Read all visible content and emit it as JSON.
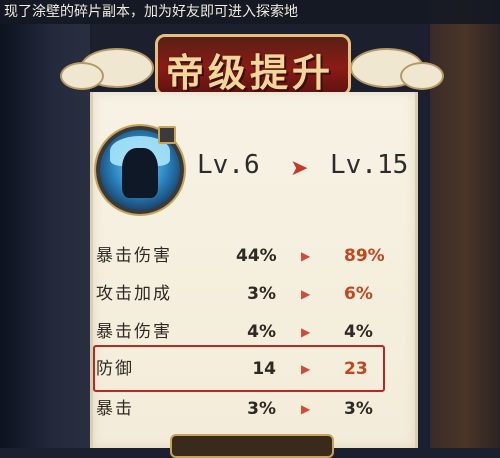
{
  "banner": {
    "text": "现了涂壁的碎片副本，加为好友即可进入探索地"
  },
  "title": "帝级提升",
  "level": {
    "from": "Lv.6",
    "to": "Lv.15"
  },
  "stats": [
    {
      "label": "暴击伤害",
      "from": "44%",
      "to": "89%",
      "changed": true
    },
    {
      "label": "攻击加成",
      "from": "3%",
      "to": "6%",
      "changed": true
    },
    {
      "label": "暴击伤害",
      "from": "4%",
      "to": "4%",
      "changed": false
    },
    {
      "label": "防御",
      "from": "14",
      "to": "23",
      "changed": true
    },
    {
      "label": "暴击",
      "from": "3%",
      "to": "3%",
      "changed": false
    }
  ],
  "highlight_row": "防御",
  "colors": {
    "increase": "#c2461e",
    "arrow": "#d24b3a",
    "highlight_border": "#b22a22",
    "title": "#f3d79a"
  }
}
